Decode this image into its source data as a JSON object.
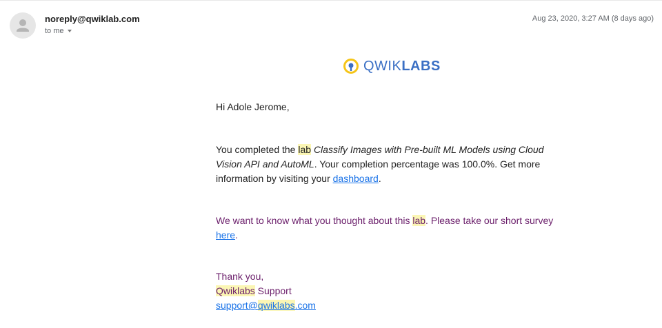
{
  "header": {
    "sender": "noreply@qwiklab.com",
    "recipient": "to me",
    "date": "Aug 23, 2020, 3:27 AM (8 days ago)"
  },
  "logo": {
    "text_light": "QWIK",
    "text_bold": "LABS",
    "colors": {
      "ring": "#f5c518",
      "text": "#3a6fc4"
    }
  },
  "body": {
    "greeting": "Hi Adole Jerome,",
    "para1": {
      "prefix": "You completed the ",
      "lab_word": "lab",
      "lab_title": "Classify Images with Pre-built ML Models using Cloud Vision API and AutoML",
      "middle": ". Your completion percentage was 100.0%. Get more information by visiting your ",
      "link_text": "dashboard",
      "suffix": "."
    },
    "para2": {
      "prefix": "We want to know what you thought about this ",
      "lab_word": "lab",
      "middle": ". Please take our short survey ",
      "link_text": "here",
      "suffix": "."
    },
    "signoff": {
      "thanks": "Thank you,",
      "company": "Qwiklabs",
      "support_word": " Support",
      "email_user": "support@",
      "email_domain_hl": "qwiklabs",
      "email_tld": ".com"
    }
  }
}
